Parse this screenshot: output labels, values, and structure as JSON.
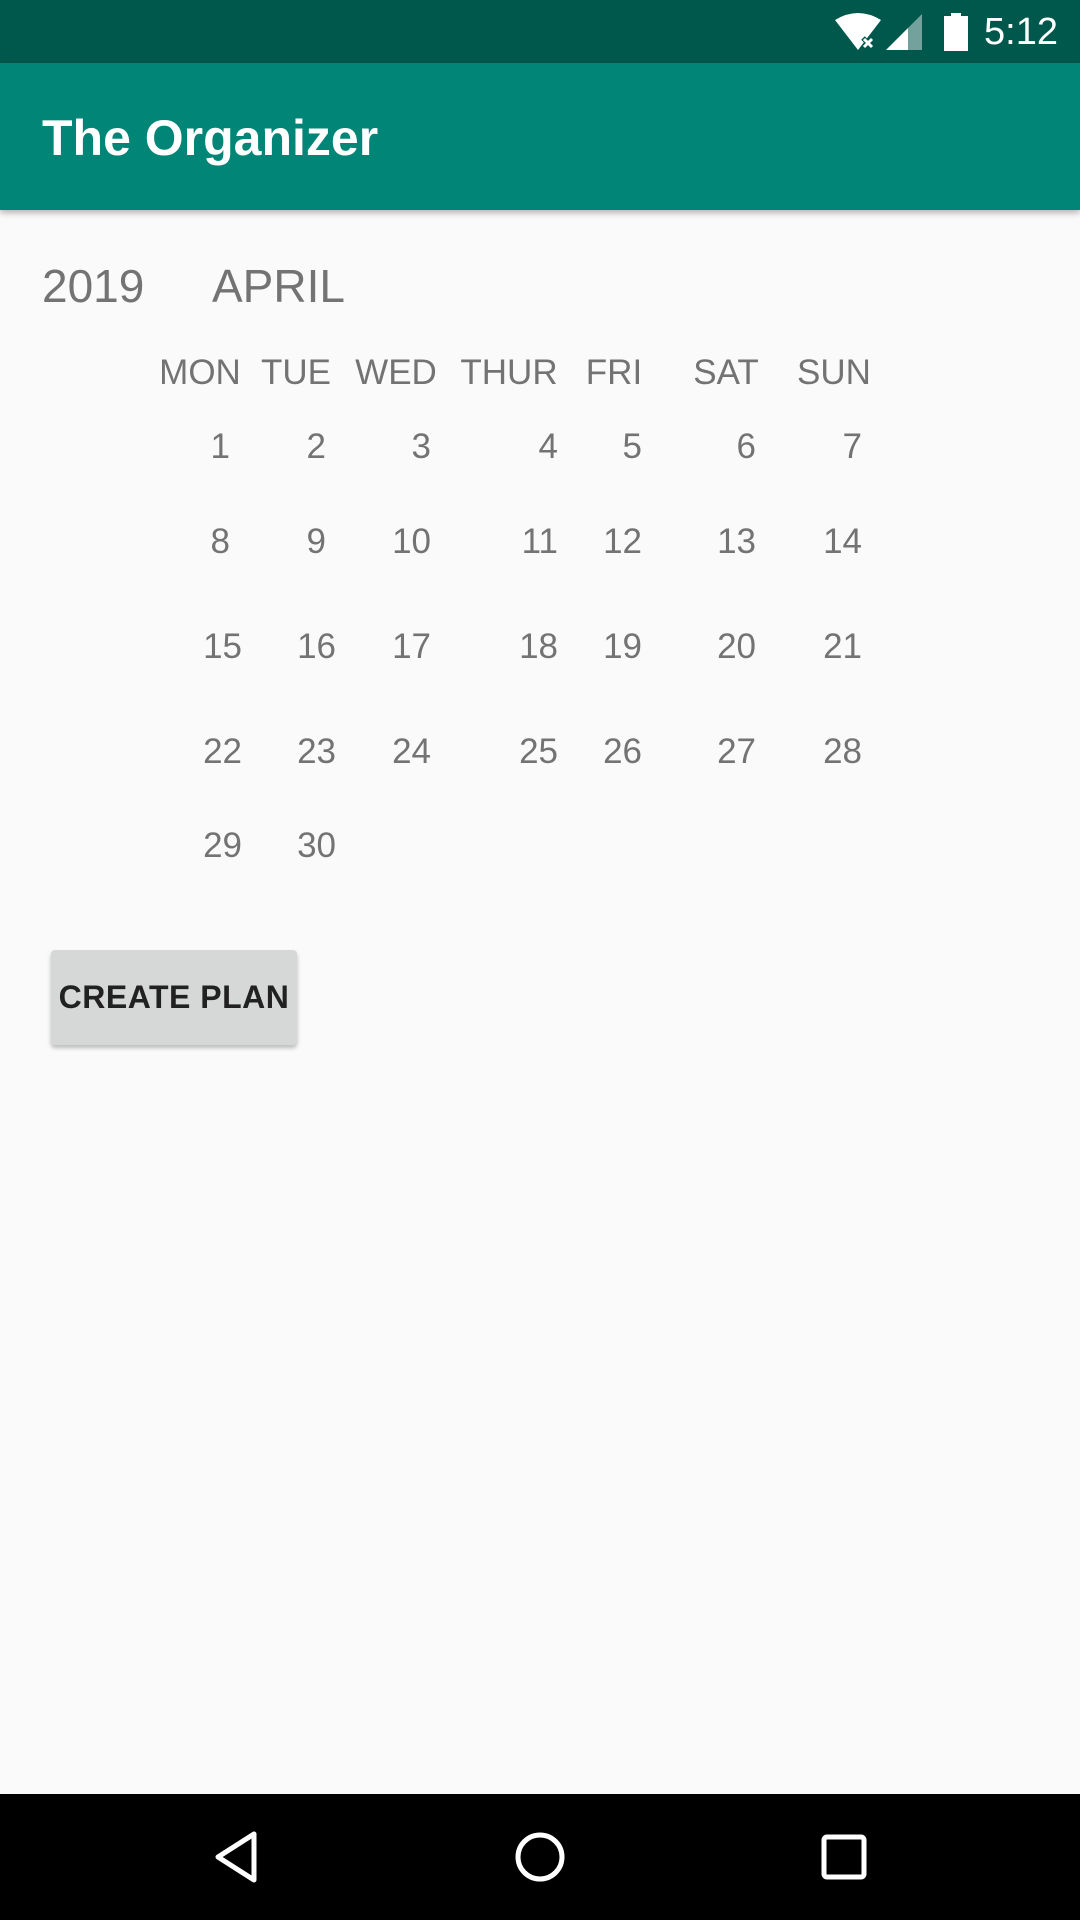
{
  "status_bar": {
    "time": "5:12",
    "icons": [
      "wifi-icon",
      "cellular-signal-icon",
      "battery-icon"
    ]
  },
  "app_bar": {
    "title": "The Organizer",
    "color": "#008577",
    "status_color": "#00574b"
  },
  "calendar": {
    "year": "2019",
    "month": "APRIL",
    "weekdays": [
      "MON",
      "TUE",
      "WED",
      "THUR",
      "FRI",
      "SAT",
      "SUN"
    ],
    "weeks": [
      [
        "1",
        "2",
        "3",
        "4",
        "5",
        "6",
        "7"
      ],
      [
        "8",
        "9",
        "10",
        "11",
        "12",
        "13",
        "14"
      ],
      [
        "15",
        "16",
        "17",
        "18",
        "19",
        "20",
        "21"
      ],
      [
        "22",
        "23",
        "24",
        "25",
        "26",
        "27",
        "28"
      ],
      [
        "29",
        "30"
      ]
    ]
  },
  "actions": {
    "create_plan_label": "CREATE PLAN"
  },
  "nav_bar": {
    "buttons": [
      "back-icon",
      "home-icon",
      "recents-icon"
    ]
  }
}
